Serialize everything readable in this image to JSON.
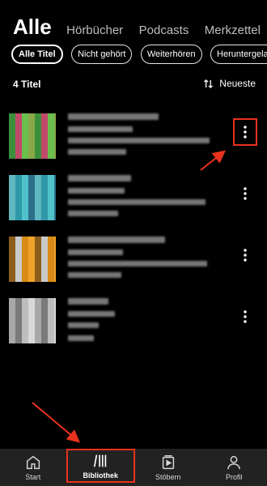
{
  "tabs": [
    {
      "label": "Alle",
      "active": true
    },
    {
      "label": "Hörbücher",
      "active": false
    },
    {
      "label": "Podcasts",
      "active": false
    },
    {
      "label": "Merkzettel",
      "active": false
    }
  ],
  "filters": [
    {
      "label": "Alle Titel",
      "active": true
    },
    {
      "label": "Nicht gehört",
      "active": false
    },
    {
      "label": "Weiterhören",
      "active": false
    },
    {
      "label": "Heruntergeladen",
      "active": false
    }
  ],
  "list_header": {
    "count": "4 Titel",
    "sort_label": "Neueste"
  },
  "items": [
    {
      "cover_colors": [
        "#3b8f3a",
        "#c04a6a",
        "#6bbf4c",
        "#8aa84a"
      ]
    },
    {
      "cover_colors": [
        "#2f98a8",
        "#4ec2c8",
        "#2c6f8a",
        "#5fb7bf"
      ]
    },
    {
      "cover_colors": [
        "#d98a17",
        "#f0a32a",
        "#8c5e1d",
        "#c9c9c9"
      ]
    },
    {
      "cover_colors": [
        "#d9d9d9",
        "#a8a8a8",
        "#7a7a7a",
        "#bdbdbd"
      ]
    }
  ],
  "bottom_nav": [
    {
      "label": "Start",
      "icon": "home-icon",
      "active": false
    },
    {
      "label": "Bibliothek",
      "icon": "library-icon",
      "active": true
    },
    {
      "label": "Stöbern",
      "icon": "browse-icon",
      "active": false
    },
    {
      "label": "Profil",
      "icon": "profile-icon",
      "active": false
    }
  ],
  "annotation_color": "#e8321d"
}
